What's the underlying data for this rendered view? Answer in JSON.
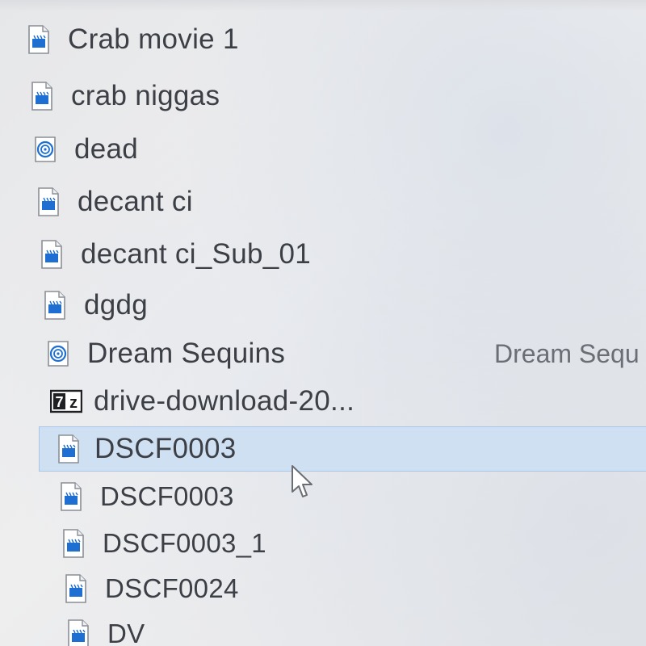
{
  "file_list": {
    "items": [
      {
        "name": "Crab movie 1",
        "icon": "video-file-icon"
      },
      {
        "name": "crab niggas",
        "icon": "video-file-icon"
      },
      {
        "name": "dead",
        "icon": "disc-image-icon"
      },
      {
        "name": "decant ci",
        "icon": "video-file-icon"
      },
      {
        "name": "decant ci_Sub_01",
        "icon": "video-file-icon"
      },
      {
        "name": "dgdg",
        "icon": "video-file-icon"
      },
      {
        "name": "Dream Sequins",
        "icon": "disc-image-icon",
        "title": "Dream Sequ"
      },
      {
        "name": "drive-download-20...",
        "icon": "7z-archive-icon"
      },
      {
        "name": "DSCF0003",
        "icon": "video-file-icon",
        "selected": true
      },
      {
        "name": "DSCF0003",
        "icon": "video-file-icon"
      },
      {
        "name": "DSCF0003_1",
        "icon": "video-file-icon"
      },
      {
        "name": "DSCF0024",
        "icon": "video-file-icon"
      },
      {
        "name": "DV",
        "icon": "video-file-icon"
      }
    ]
  },
  "colors": {
    "selection": "#cfe0f2",
    "selection_border": "#a9c6e6",
    "icon_blue": "#1e6fd1",
    "text": "#3c4046"
  }
}
